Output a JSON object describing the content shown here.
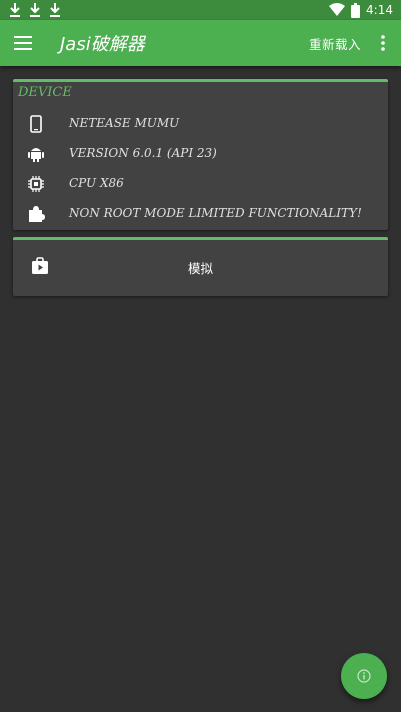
{
  "status_bar": {
    "time": "4:14",
    "notification_icons": [
      "download-icon",
      "download-icon",
      "download-icon"
    ],
    "system_icons": [
      "wifi-icon",
      "battery-icon"
    ]
  },
  "toolbar": {
    "title": "Jasi破解器",
    "reload_label": "重新载入",
    "menu_icon": "hamburger-menu-icon",
    "overflow_icon": "more-vertical-icon"
  },
  "device_card": {
    "header": "DEVICE",
    "rows": [
      {
        "icon": "phone-icon",
        "text": "NETEASE MUMU"
      },
      {
        "icon": "android-icon",
        "text": "VERSION 6.0.1 (API 23)"
      },
      {
        "icon": "chip-icon",
        "text": "CPU X86"
      },
      {
        "icon": "puzzle-icon",
        "text": "NON ROOT MODE LIMITED FUNCTIONALITY!"
      }
    ]
  },
  "simulate_card": {
    "icon": "play-store-icon",
    "label": "模拟"
  },
  "fab": {
    "icon": "info-icon"
  },
  "colors": {
    "status_bar": "#3d8b3d",
    "toolbar": "#4caf50",
    "background": "#303030",
    "card": "#424242",
    "accent": "#66bb6a",
    "text": "#e0e0e0"
  }
}
